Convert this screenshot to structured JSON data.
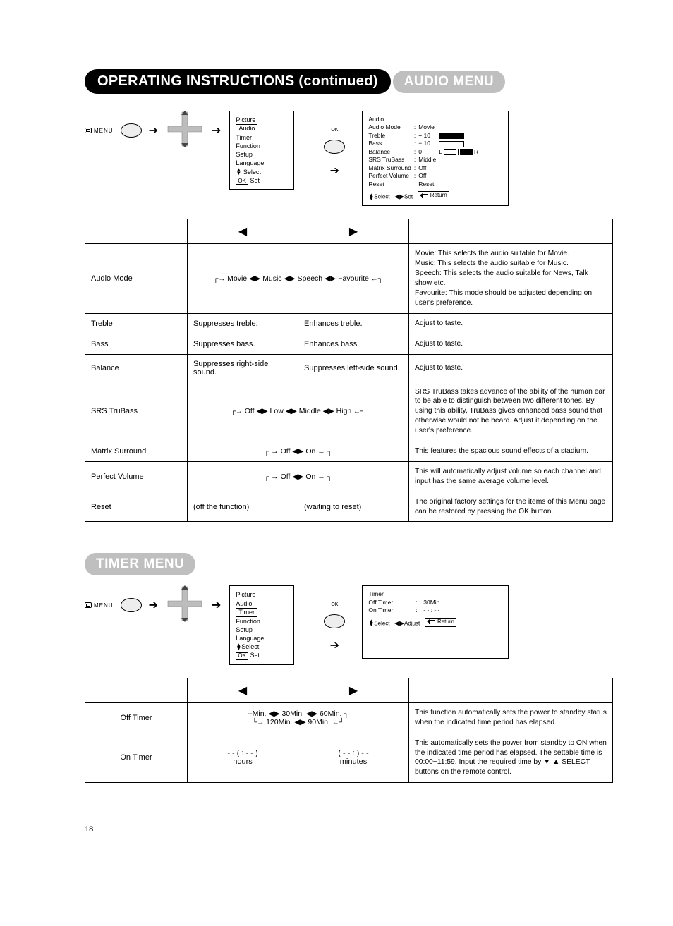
{
  "page_number": "18",
  "page_title": "OPERATING INSTRUCTIONS (continued)",
  "sections": {
    "audio": {
      "title": "AUDIO MENU"
    },
    "timer": {
      "title": "TIMER MENU"
    }
  },
  "nav": {
    "menu_label": "MENU",
    "ok_label": "OK",
    "osd_main": {
      "items": [
        "Picture",
        "Audio",
        "Timer",
        "Function",
        "Setup",
        "Language"
      ],
      "sel_audio": "Audio",
      "sel_timer": "Timer",
      "select_hint": "Select",
      "set_hint": "Set",
      "ok": "OK"
    },
    "osd_audio": {
      "title": "Audio",
      "rows": [
        {
          "label": "Audio Mode",
          "value": "Movie",
          "sel": true
        },
        {
          "label": "Treble",
          "value": "+ 10",
          "bar": "full"
        },
        {
          "label": "Bass",
          "value": "− 10",
          "bar": "empty"
        },
        {
          "label": "Balance",
          "value": "0",
          "balance": true
        },
        {
          "label": "SRS TruBass",
          "value": "Middle"
        },
        {
          "label": "Matrix Surround",
          "value": "Off"
        },
        {
          "label": "Perfect Volume",
          "value": "Off"
        },
        {
          "label": "Reset",
          "value": "Reset"
        }
      ],
      "hints": {
        "select": "Select",
        "set": "Set",
        "return": "Return"
      }
    },
    "osd_timer": {
      "title": "Timer",
      "rows": [
        {
          "label": "Off Timer",
          "value": "30Min.",
          "sel": true
        },
        {
          "label": "On Timer",
          "value": "- - : - -"
        }
      ],
      "hints": {
        "select": "Select",
        "adjust": "Adjust",
        "return": "Return"
      }
    }
  },
  "audio_table": {
    "left_arrow": "◀",
    "right_arrow": "▶",
    "rows": [
      {
        "name": "Audio Mode",
        "seq": "Movie ◀▶ Music ◀▶ Speech ◀▶ Favourite",
        "colspan_seq": true,
        "desc": "Movie: This selects the audio suitable for Movie.\nMusic: This selects the audio suitable for Music.\nSpeech: This selects the audio suitable for News, Talk show etc.\nFavourite: This mode should be adjusted depending on user's preference."
      },
      {
        "name": "Treble",
        "left": "Suppresses treble.",
        "right": "Enhances treble.",
        "desc": "Adjust to taste."
      },
      {
        "name": "Bass",
        "left": "Suppresses bass.",
        "right": "Enhances bass.",
        "desc": "Adjust to taste."
      },
      {
        "name": "Balance",
        "left": "Suppresses right-side sound.",
        "right": "Suppresses left-side sound.",
        "desc": "Adjust to taste."
      },
      {
        "name": "SRS TruBass",
        "seq": "Off ◀▶ Low ◀▶ Middle ◀▶ High",
        "colspan_seq": true,
        "desc": "SRS TruBass takes advance of the ability of the human ear to be able to distinguish between two different tones. By using this ability, TruBass gives enhanced bass sound that otherwise would not be heard. Adjust it depending on the user's preference."
      },
      {
        "name": "Matrix Surround",
        "seq": "Off ◀▶ On",
        "colspan_seq": true,
        "desc": "This features the spacious sound effects of a stadium."
      },
      {
        "name": "Perfect Volume",
        "seq": "Off ◀▶ On",
        "colspan_seq": true,
        "desc": "This will automatically adjust volume so each channel and input has the same average volume level."
      },
      {
        "name": "Reset",
        "left": "(off the function)",
        "right": "(waiting to reset)",
        "desc": "The original factory settings for the items of this Menu page can be restored by pressing the OK button."
      }
    ]
  },
  "timer_table": {
    "left_arrow": "◀",
    "right_arrow": "▶",
    "rows": [
      {
        "name": "Off Timer",
        "seq_line1": "--Min. ◀▶ 30Min. ◀▶ 60Min.",
        "seq_line2": "120Min. ◀▶ 90Min.",
        "colspan_seq": true,
        "desc": "This function automatically sets the power to standby status when the indicated time period has elapsed."
      },
      {
        "name": "On Timer",
        "left": "- - ( : - - )\nhours",
        "right": "( - -  : ) - -\nminutes",
        "desc": "This automatically sets the power from standby to ON when the indicated time period has elapsed. The settable time is 00:00~11:59. Input the required time by ▼ ▲ SELECT buttons on the remote control."
      }
    ]
  }
}
